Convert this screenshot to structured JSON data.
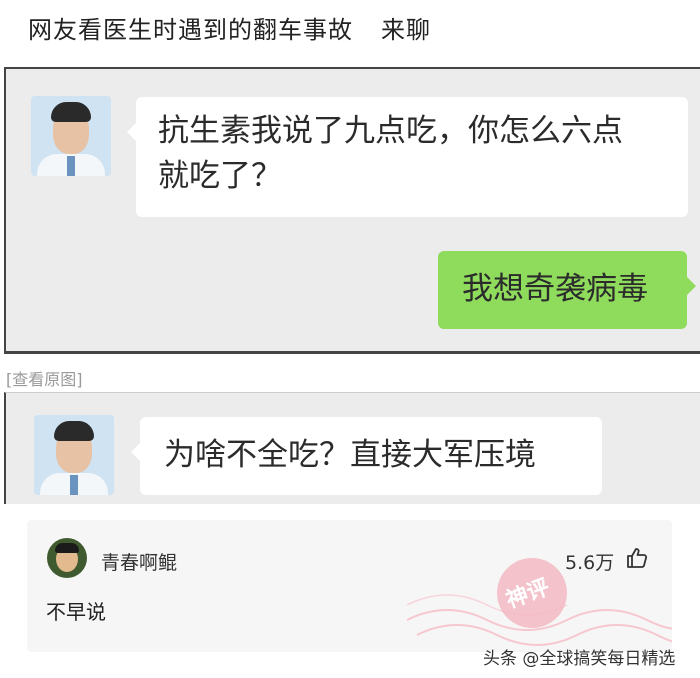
{
  "post": {
    "title": "网友看医生时遇到的翻车事故",
    "tag": "来聊"
  },
  "chat1": {
    "doctor_message": "抗生素我说了九点吃，你怎么六点就吃了？",
    "doctor_message_line1": "抗生素我说了九点吃，你怎么六点",
    "doctor_message_line2": "就吃了？",
    "user_reply": "我想奇袭病毒"
  },
  "view_original": "[查看原图]",
  "chat2": {
    "doctor_message": "为啥不全吃？直接大军压境"
  },
  "comment": {
    "username": "青春啊鲲",
    "likes": "5.6万",
    "text": "不早说",
    "badge": "神评"
  },
  "watermark": "头条 @全球搞笑每日精选",
  "colors": {
    "green_bubble": "#8fdc5d",
    "chat_bg": "#ececec",
    "badge": "#f3b8c3"
  }
}
